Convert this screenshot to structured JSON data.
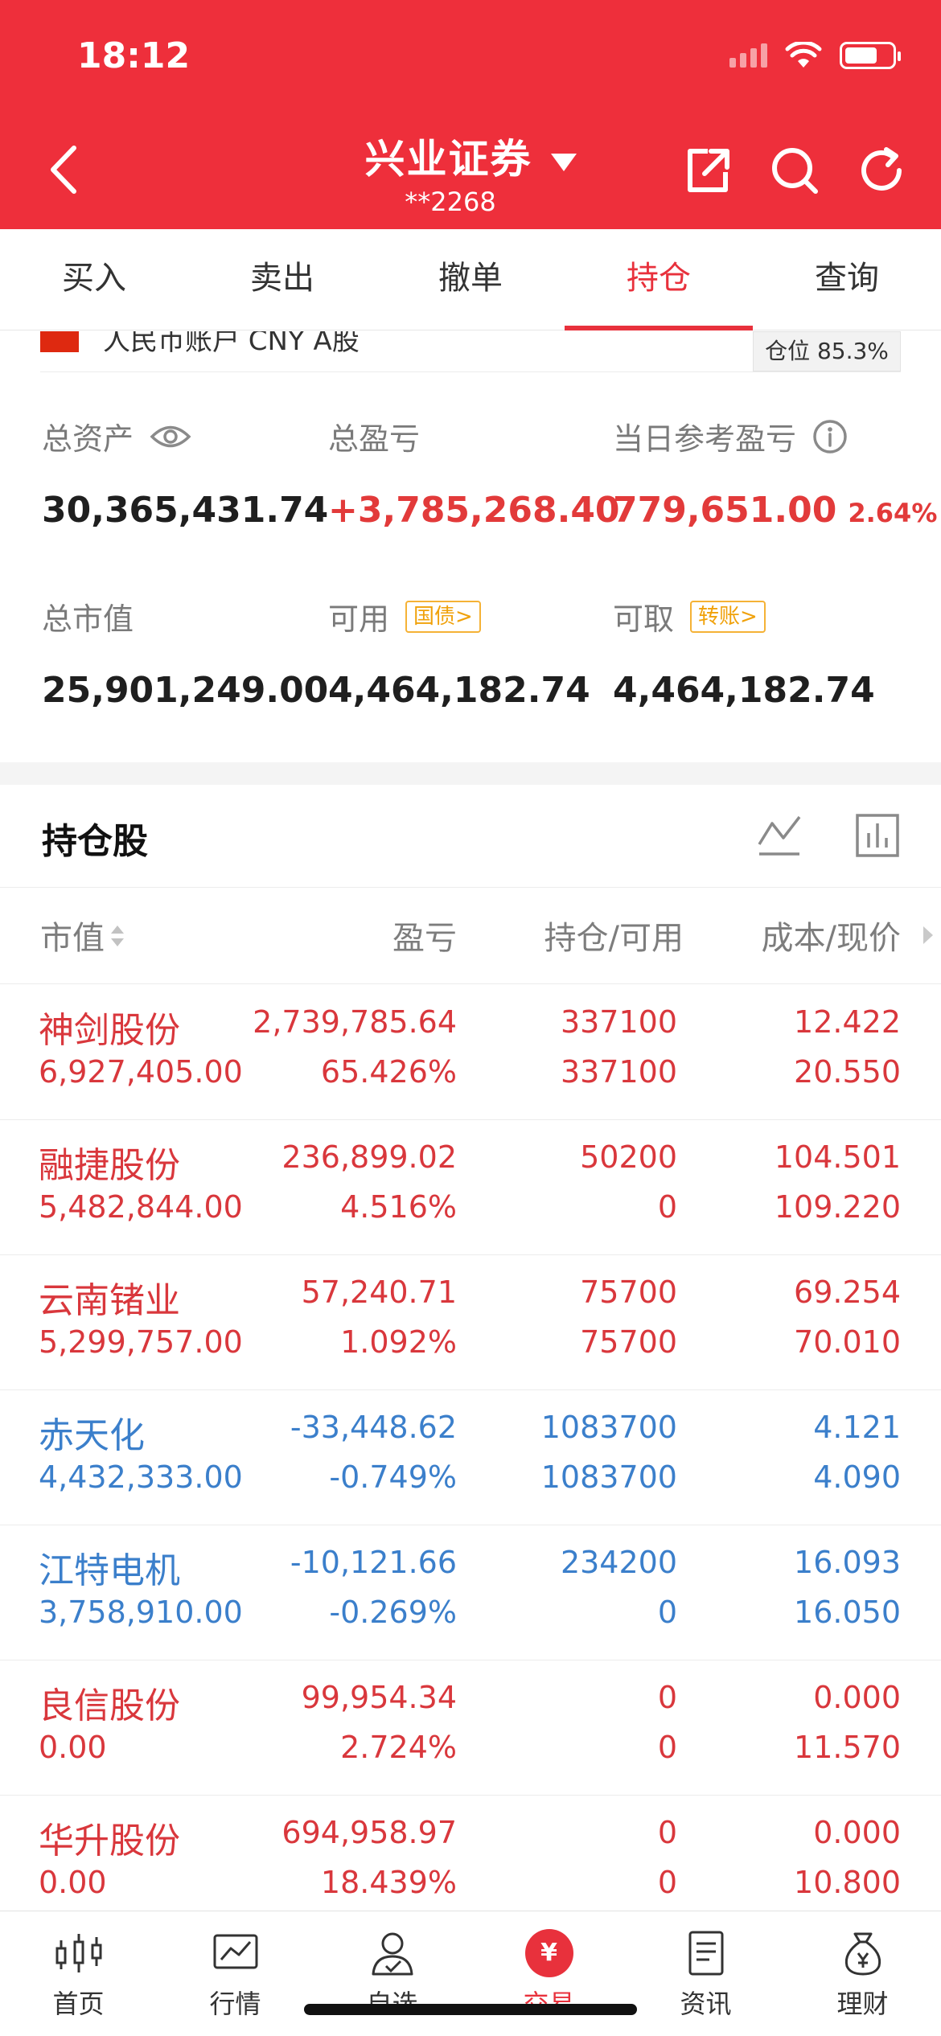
{
  "status_bar": {
    "time": "18:12"
  },
  "nav": {
    "title": "兴业证券",
    "account": "**2268"
  },
  "tabs": [
    "买入",
    "卖出",
    "撤单",
    "持仓",
    "查询"
  ],
  "active_tab": "持仓",
  "account": {
    "label": "人民币账户 CNY A股",
    "position_badge": "仓位 85.3%"
  },
  "summary": {
    "total_assets_label": "总资产",
    "total_assets": "30,365,431.74",
    "total_pl_label": "总盈亏",
    "total_pl": "+3,785,268.40",
    "daily_pl_label": "当日参考盈亏",
    "daily_pl": "779,651.00",
    "daily_pl_pct": "2.64%",
    "market_value_label": "总市值",
    "market_value": "25,901,249.00",
    "available_label": "可用",
    "available_tag": "国债>",
    "available": "4,464,182.74",
    "withdrawable_label": "可取",
    "withdrawable_tag": "转账>",
    "withdrawable": "4,464,182.74"
  },
  "holdings": {
    "title": "持仓股",
    "columns": {
      "market_value": "市值",
      "pl": "盈亏",
      "position": "持仓/可用",
      "cost": "成本/现价"
    },
    "rows": [
      {
        "name": "神剑股份",
        "market_value": "6,927,405.00",
        "pl": "2,739,785.64",
        "pl_pct": "65.426%",
        "position": "337100",
        "available": "337100",
        "cost": "12.422",
        "price": "20.550",
        "color": "#d9373c"
      },
      {
        "name": "融捷股份",
        "market_value": "5,482,844.00",
        "pl": "236,899.02",
        "pl_pct": "4.516%",
        "position": "50200",
        "available": "0",
        "cost": "104.501",
        "price": "109.220",
        "color": "#d9373c"
      },
      {
        "name": "云南锗业",
        "market_value": "5,299,757.00",
        "pl": "57,240.71",
        "pl_pct": "1.092%",
        "position": "75700",
        "available": "75700",
        "cost": "69.254",
        "price": "70.010",
        "color": "#d9373c"
      },
      {
        "name": "赤天化",
        "market_value": "4,432,333.00",
        "pl": "-33,448.62",
        "pl_pct": "-0.749%",
        "position": "1083700",
        "available": "1083700",
        "cost": "4.121",
        "price": "4.090",
        "color": "#3b7fcb"
      },
      {
        "name": "江特电机",
        "market_value": "3,758,910.00",
        "pl": "-10,121.66",
        "pl_pct": "-0.269%",
        "position": "234200",
        "available": "0",
        "cost": "16.093",
        "price": "16.050",
        "color": "#3b7fcb"
      },
      {
        "name": "良信股份",
        "market_value": "0.00",
        "pl": "99,954.34",
        "pl_pct": "2.724%",
        "position": "0",
        "available": "0",
        "cost": "0.000",
        "price": "11.570",
        "color": "#d9373c"
      },
      {
        "name": "华升股份",
        "market_value": "0.00",
        "pl": "694,958.97",
        "pl_pct": "18.439%",
        "position": "0",
        "available": "0",
        "cost": "0.000",
        "price": "10.800",
        "color": "#d9373c"
      }
    ]
  },
  "bottom_tabs": [
    "首页",
    "行情",
    "自选",
    "交易",
    "资讯",
    "理财"
  ],
  "active_bottom_tab": "交易",
  "trade_icon_glyph": "¥",
  "colors": {
    "brand_red": "#ee2f3b",
    "up_red": "#d9373c",
    "down_blue": "#3b7fcb",
    "tag_orange": "#f0a10a"
  }
}
